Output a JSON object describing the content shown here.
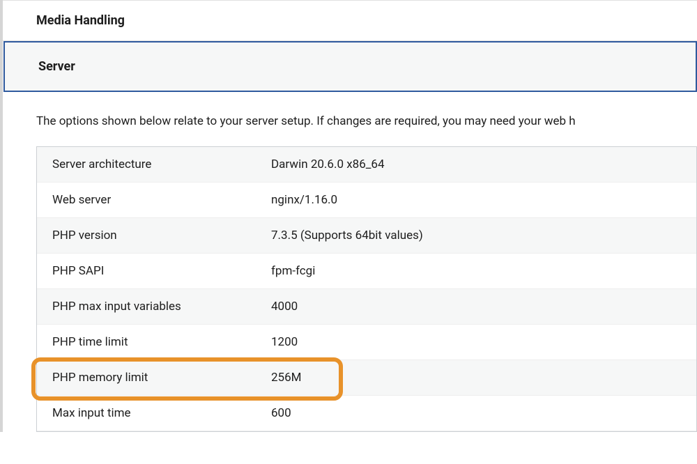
{
  "panels": {
    "media_handling": {
      "title": "Media Handling"
    },
    "server": {
      "title": "Server",
      "description": "The options shown below relate to your server setup. If changes are required, you may need your web h",
      "rows": [
        {
          "label": "Server architecture",
          "value": "Darwin 20.6.0 x86_64",
          "highlighted": false
        },
        {
          "label": "Web server",
          "value": "nginx/1.16.0",
          "highlighted": false
        },
        {
          "label": "PHP version",
          "value": "7.3.5 (Supports 64bit values)",
          "highlighted": false
        },
        {
          "label": "PHP SAPI",
          "value": "fpm-fcgi",
          "highlighted": false
        },
        {
          "label": "PHP max input variables",
          "value": "4000",
          "highlighted": false
        },
        {
          "label": "PHP time limit",
          "value": "1200",
          "highlighted": false
        },
        {
          "label": "PHP memory limit",
          "value": "256M",
          "highlighted": true
        },
        {
          "label": "Max input time",
          "value": "600",
          "highlighted": false
        }
      ]
    }
  }
}
